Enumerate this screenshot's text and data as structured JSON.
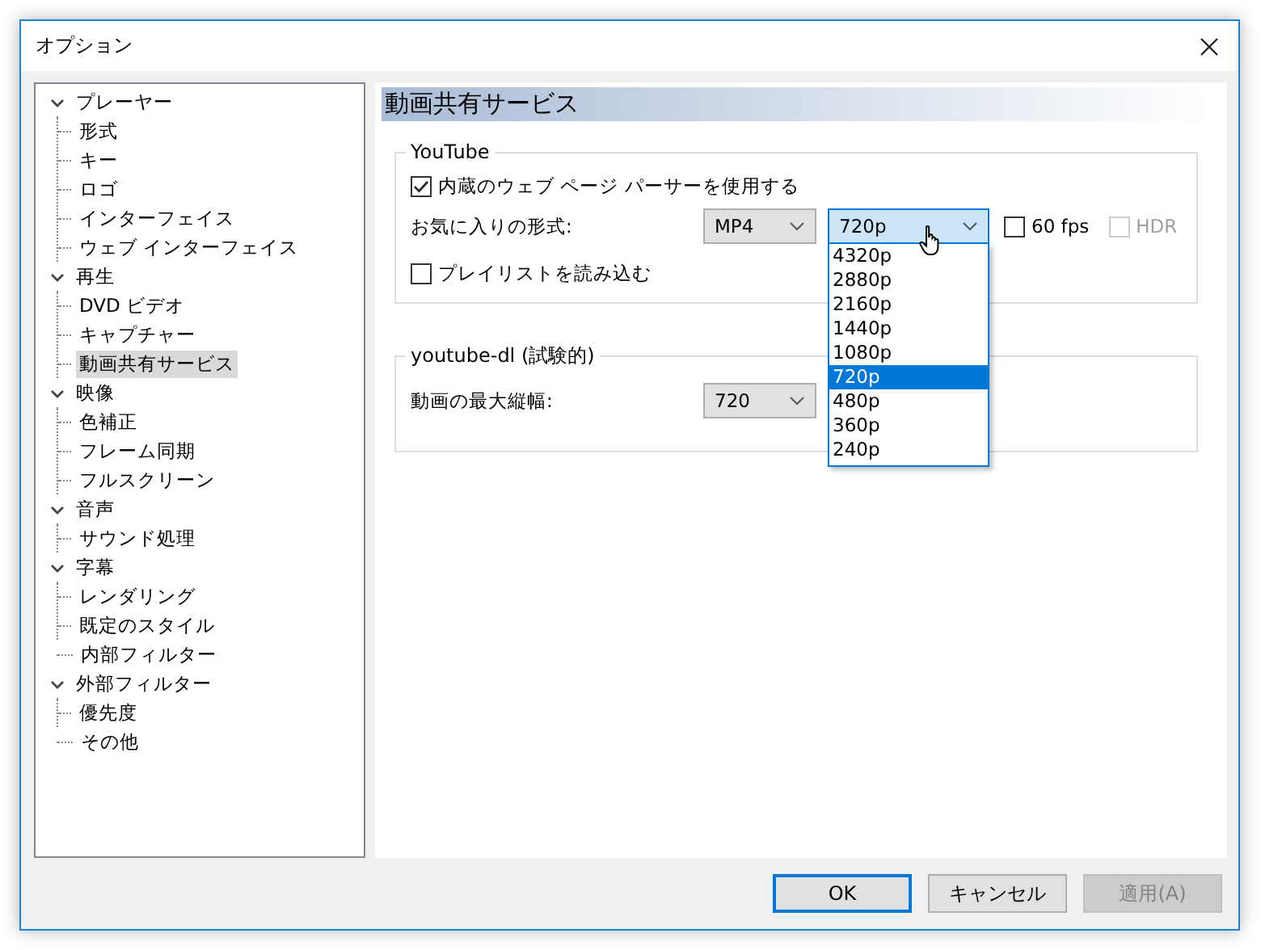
{
  "window": {
    "title": "オプション"
  },
  "tree": [
    {
      "label": "プレーヤー",
      "expanded": true,
      "selected": false,
      "children": [
        {
          "label": "形式",
          "selected": false
        },
        {
          "label": "キー",
          "selected": false
        },
        {
          "label": "ロゴ",
          "selected": false
        },
        {
          "label": "インターフェイス",
          "selected": false
        },
        {
          "label": "ウェブ インターフェイス",
          "selected": false
        }
      ]
    },
    {
      "label": "再生",
      "expanded": true,
      "selected": false,
      "children": [
        {
          "label": "DVD ビデオ",
          "selected": false
        },
        {
          "label": "キャプチャー",
          "selected": false
        },
        {
          "label": "動画共有サービス",
          "selected": true
        }
      ]
    },
    {
      "label": "映像",
      "expanded": true,
      "selected": false,
      "children": [
        {
          "label": "色補正",
          "selected": false
        },
        {
          "label": "フレーム同期",
          "selected": false
        },
        {
          "label": "フルスクリーン",
          "selected": false
        }
      ]
    },
    {
      "label": "音声",
      "expanded": true,
      "selected": false,
      "children": [
        {
          "label": "サウンド処理",
          "selected": false
        }
      ]
    },
    {
      "label": "字幕",
      "expanded": true,
      "selected": false,
      "children": [
        {
          "label": "レンダリング",
          "selected": false
        },
        {
          "label": "既定のスタイル",
          "selected": false
        }
      ]
    },
    {
      "label": "内部フィルター",
      "selected": false
    },
    {
      "label": "外部フィルター",
      "expanded": true,
      "selected": false,
      "children": [
        {
          "label": "優先度",
          "selected": false
        }
      ]
    },
    {
      "label": "その他",
      "selected": false
    }
  ],
  "panel_title": "動画共有サービス",
  "youtube": {
    "title": "YouTube",
    "use_parser": {
      "label": "内蔵のウェブ ページ パーサーを使用する",
      "checked": true
    },
    "format_label": "お気に入りの形式:",
    "container": {
      "value": "MP4"
    },
    "resolution": {
      "value": "720p",
      "open": true,
      "options": [
        {
          "label": "4320p",
          "selected": false
        },
        {
          "label": "2880p",
          "selected": false
        },
        {
          "label": "2160p",
          "selected": false
        },
        {
          "label": "1440p",
          "selected": false
        },
        {
          "label": "1080p",
          "selected": false
        },
        {
          "label": "720p",
          "selected": true
        },
        {
          "label": "480p",
          "selected": false
        },
        {
          "label": "360p",
          "selected": false
        },
        {
          "label": "240p",
          "selected": false
        }
      ]
    },
    "fps60": {
      "label": "60 fps",
      "checked": false,
      "disabled": false
    },
    "hdr": {
      "label": "HDR",
      "checked": false,
      "disabled": true
    },
    "playlist": {
      "label": "プレイリストを読み込む",
      "checked": false
    }
  },
  "youtube_dl": {
    "title": "youtube-dl (試験的)",
    "max_height_label": "動画の最大縦幅:",
    "max_height": {
      "value": "720"
    }
  },
  "buttons": [
    {
      "label": "OK",
      "default": true,
      "disabled": false
    },
    {
      "label": "キャンセル",
      "default": false,
      "disabled": false
    },
    {
      "label": "適用(A)",
      "default": false,
      "disabled": true
    }
  ]
}
